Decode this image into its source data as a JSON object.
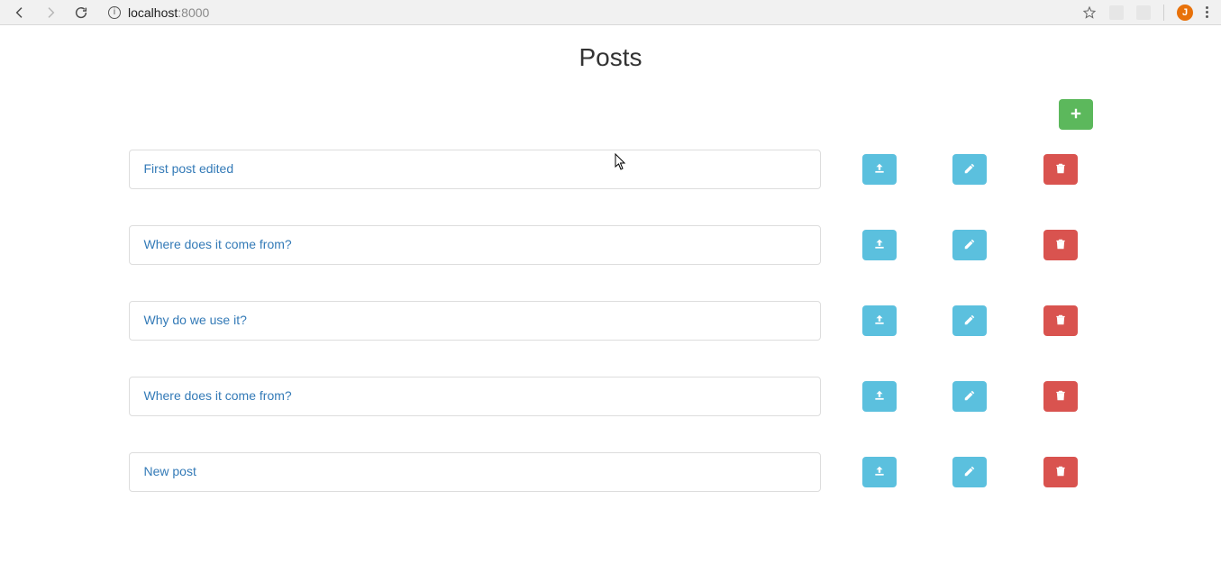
{
  "browser": {
    "url_host": "localhost",
    "url_port": ":8000",
    "avatar_initial": "J"
  },
  "page": {
    "title": "Posts"
  },
  "posts": [
    {
      "title": "First post edited"
    },
    {
      "title": "Where does it come from?"
    },
    {
      "title": "Why do we use it?"
    },
    {
      "title": "Where does it come from?"
    },
    {
      "title": "New post"
    }
  ],
  "colors": {
    "success": "#5cb85c",
    "info": "#5bc0de",
    "danger": "#d9534f",
    "link": "#337ab7"
  }
}
